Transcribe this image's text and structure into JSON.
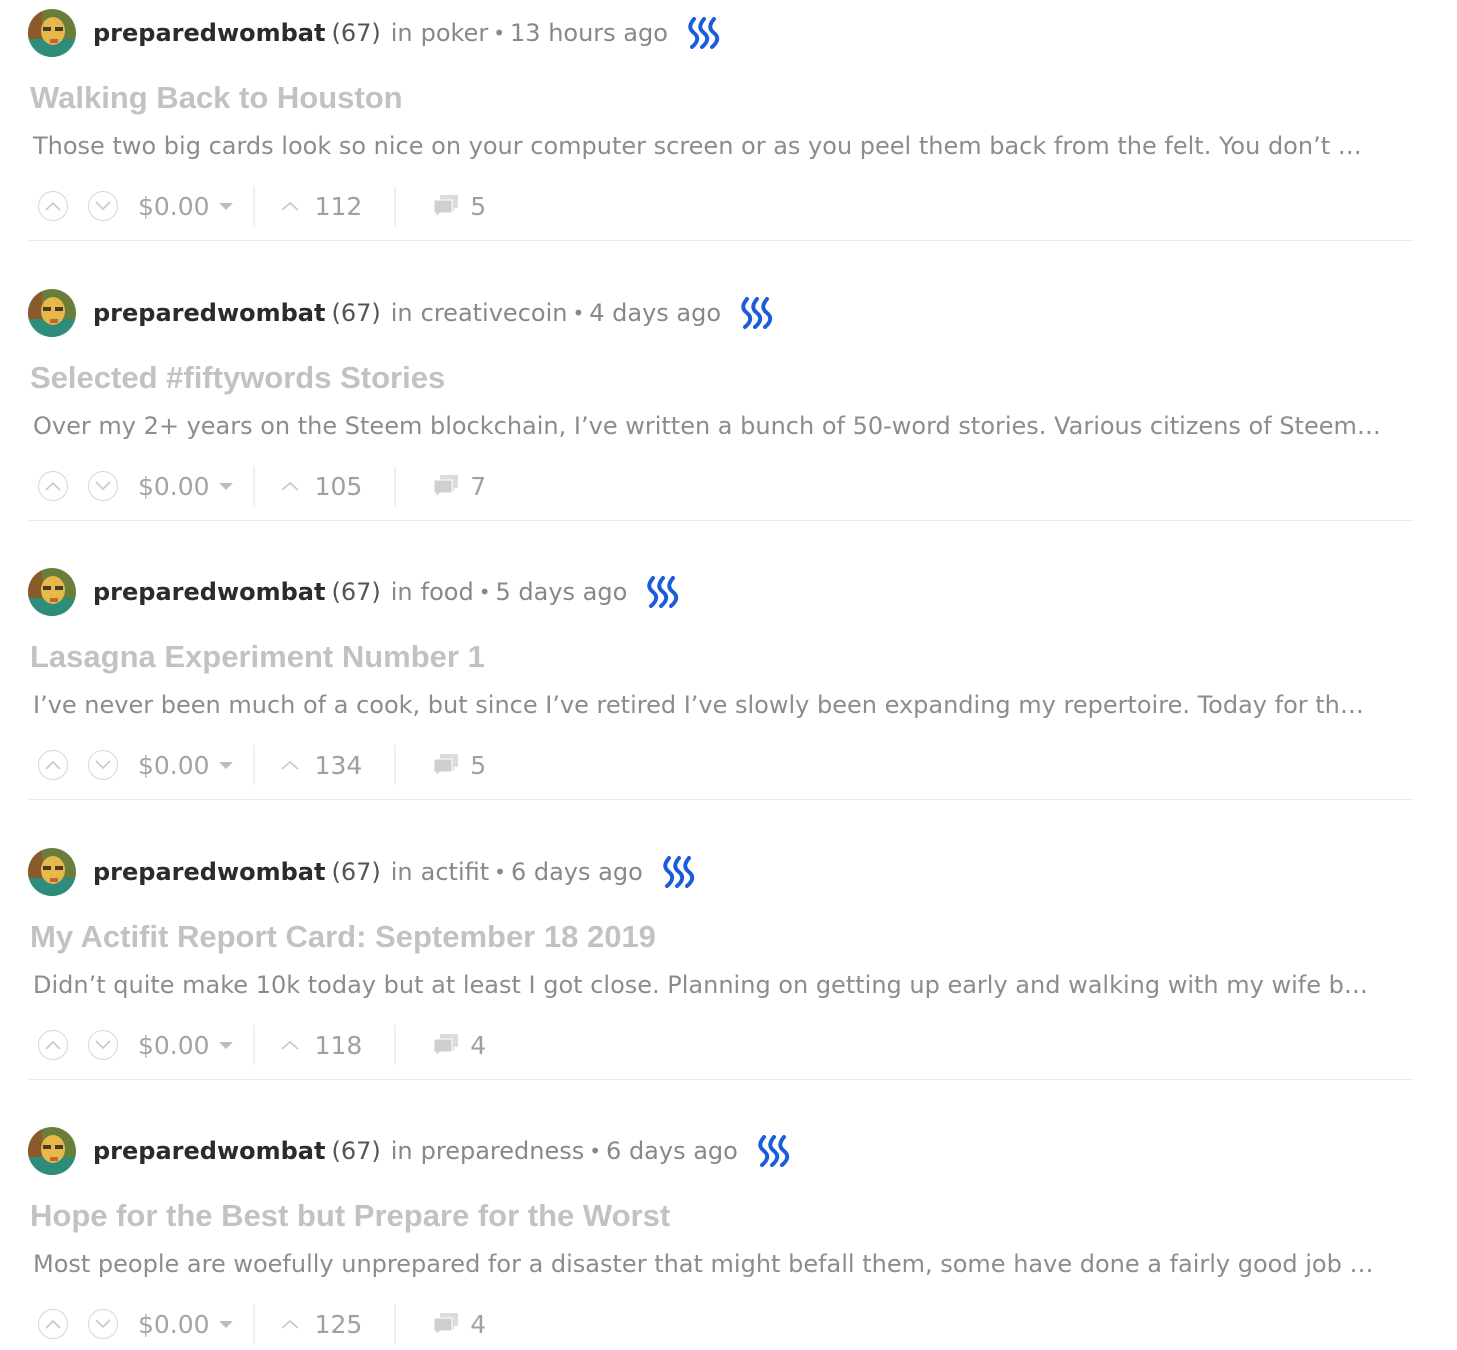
{
  "posts": [
    {
      "author": "preparedwombat",
      "reputation": "(67)",
      "in_label": "in",
      "category": "poker",
      "time": "13 hours ago",
      "title": "Walking Back to Houston",
      "excerpt": "Those two big cards look so nice on your computer screen or as you peel them back from the felt. You don’t …",
      "payout": "$0.00",
      "votes": "112",
      "comments": "5"
    },
    {
      "author": "preparedwombat",
      "reputation": "(67)",
      "in_label": "in",
      "category": "creativecoin",
      "time": "4 days ago",
      "title": "Selected #fiftywords Stories",
      "excerpt": "Over my 2+ years on the Steem blockchain, I’ve written a bunch of 50-word stories. Various citizens of Steem…",
      "payout": "$0.00",
      "votes": "105",
      "comments": "7"
    },
    {
      "author": "preparedwombat",
      "reputation": "(67)",
      "in_label": "in",
      "category": "food",
      "time": "5 days ago",
      "title": "Lasagna Experiment Number 1",
      "excerpt": "I’ve never been much of a cook, but since I’ve retired I’ve slowly been expanding my repertoire. Today for th…",
      "payout": "$0.00",
      "votes": "134",
      "comments": "5"
    },
    {
      "author": "preparedwombat",
      "reputation": "(67)",
      "in_label": "in",
      "category": "actifit",
      "time": "6 days ago",
      "title": "My Actifit Report Card: September 18 2019",
      "excerpt": "Didn’t quite make 10k today but at least I got close. Planning on getting up early and walking with my wife b…",
      "payout": "$0.00",
      "votes": "118",
      "comments": "4"
    },
    {
      "author": "preparedwombat",
      "reputation": "(67)",
      "in_label": "in",
      "category": "preparedness",
      "time": "6 days ago",
      "title": "Hope for the Best but Prepare for the Worst",
      "excerpt": "Most people are woefully unprepared for a disaster that might befall them, some have done a fairly good job …",
      "payout": "$0.00",
      "votes": "125",
      "comments": "4"
    }
  ],
  "icons": {
    "avatar": "avatar",
    "steem": "steem-logo-icon",
    "upvote": "upvote-icon",
    "downvote": "downvote-icon",
    "payout_dropdown": "caret-down-icon",
    "votes": "chevron-up-icon",
    "comments": "comments-icon"
  },
  "colors": {
    "steem_blue": "#1a5ddb",
    "title": "#c2c2c2",
    "author": "#2b2b2b",
    "muted": "#888888"
  }
}
